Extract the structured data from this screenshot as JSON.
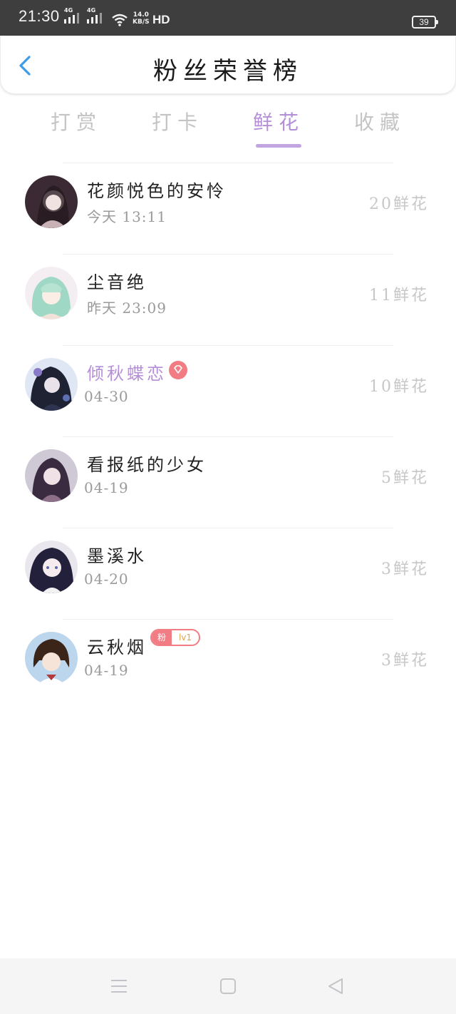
{
  "status_bar": {
    "time": "21:30",
    "signal1": "4G",
    "signal2": "4G",
    "speed_value": "14.0",
    "speed_unit": "KB/S",
    "hd": "HD",
    "battery": "39"
  },
  "header": {
    "title": "粉丝荣誉榜",
    "back_icon": "chevron-left-icon"
  },
  "tabs": [
    {
      "label": "打赏",
      "active": false
    },
    {
      "label": "打卡",
      "active": false
    },
    {
      "label": "鲜花",
      "active": true
    },
    {
      "label": "收藏",
      "active": false
    }
  ],
  "fans": [
    {
      "name": "花颜悦色的安怜",
      "date": "今天 13:11",
      "count": "20鲜花"
    },
    {
      "name": "尘音绝",
      "date": "昨天 23:09",
      "count": "11鲜花"
    },
    {
      "name": "倾秋蝶恋",
      "date": "04-30",
      "count": "10鲜花",
      "vip": true
    },
    {
      "name": "看报纸的少女",
      "date": "04-19",
      "count": "5鲜花"
    },
    {
      "name": "墨溪水",
      "date": "04-20",
      "count": "3鲜花"
    },
    {
      "name": "云秋烟",
      "date": "04-19",
      "count": "3鲜花",
      "fan_badge": {
        "left": "粉",
        "right": "lv1"
      }
    }
  ],
  "colors": {
    "accent": "#b48fd8",
    "status_bar": "#3e3e3e",
    "back": "#3d9be9",
    "badge": "#f27c84"
  },
  "navbar": {
    "icons": [
      "menu-icon",
      "home-square-icon",
      "back-triangle-icon"
    ]
  }
}
